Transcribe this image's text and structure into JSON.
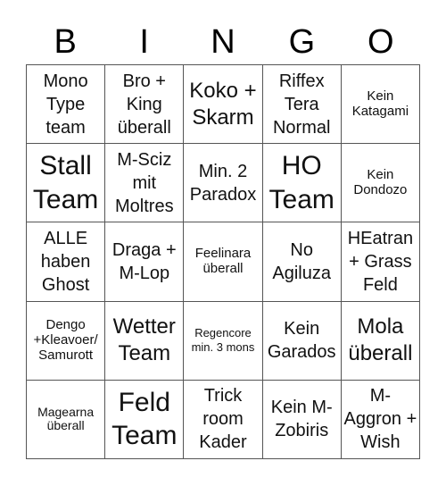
{
  "header": {
    "letters": [
      "B",
      "I",
      "N",
      "G",
      "O"
    ]
  },
  "cells": [
    [
      "Mono Type team",
      "Bro + King überall",
      "Koko + Skarm",
      "Riffex Tera Normal",
      "Kein Katagami"
    ],
    [
      "Stall Team",
      "M-Sciz mit Moltres",
      "Min. 2 Paradox",
      "HO Team",
      "Kein Dondozo"
    ],
    [
      "ALLE haben Ghost",
      "Draga + M-Lop",
      "Feelinara überall",
      "No Agiluza",
      "HEatran + Grass Feld"
    ],
    [
      "Dengo +Kleavoer/ Samurott",
      "Wetter Team",
      "Regencore min. 3 mons",
      "Kein Garados",
      "Mola überall"
    ],
    [
      "Magearna überall",
      "Feld Team",
      "Trick room Kader",
      "Kein M-Zobiris",
      "M-Aggron + Wish"
    ]
  ]
}
